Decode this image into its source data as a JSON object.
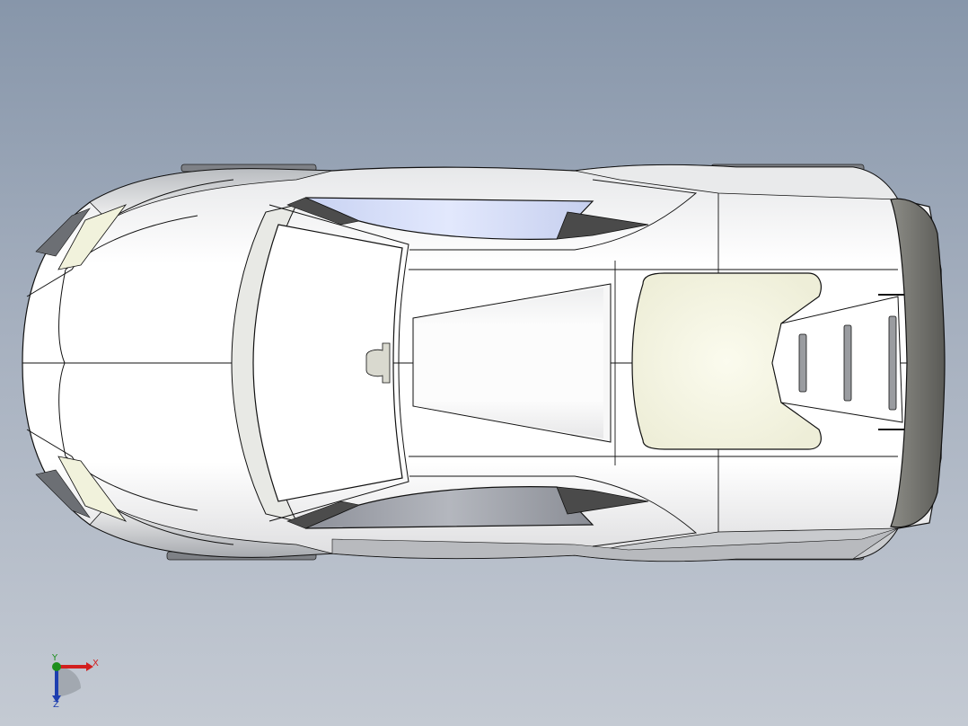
{
  "viewport": {
    "background_top": "#8796aa",
    "background_bottom": "#c4cad3"
  },
  "model": {
    "body_color": "#fdfdfd",
    "shade_color": "#d4d6d8",
    "glass_color": "#dde4fb",
    "dark_trim_color": "#4c4c4c",
    "outline_color": "#111111",
    "engine_cover_color": "#f6f6e4"
  },
  "triad": {
    "x_label": "X",
    "y_label": "Y",
    "z_label": "Z",
    "x_color": "#d21f1f",
    "y_color": "#1d8f1d",
    "z_color": "#1e3fb0"
  }
}
